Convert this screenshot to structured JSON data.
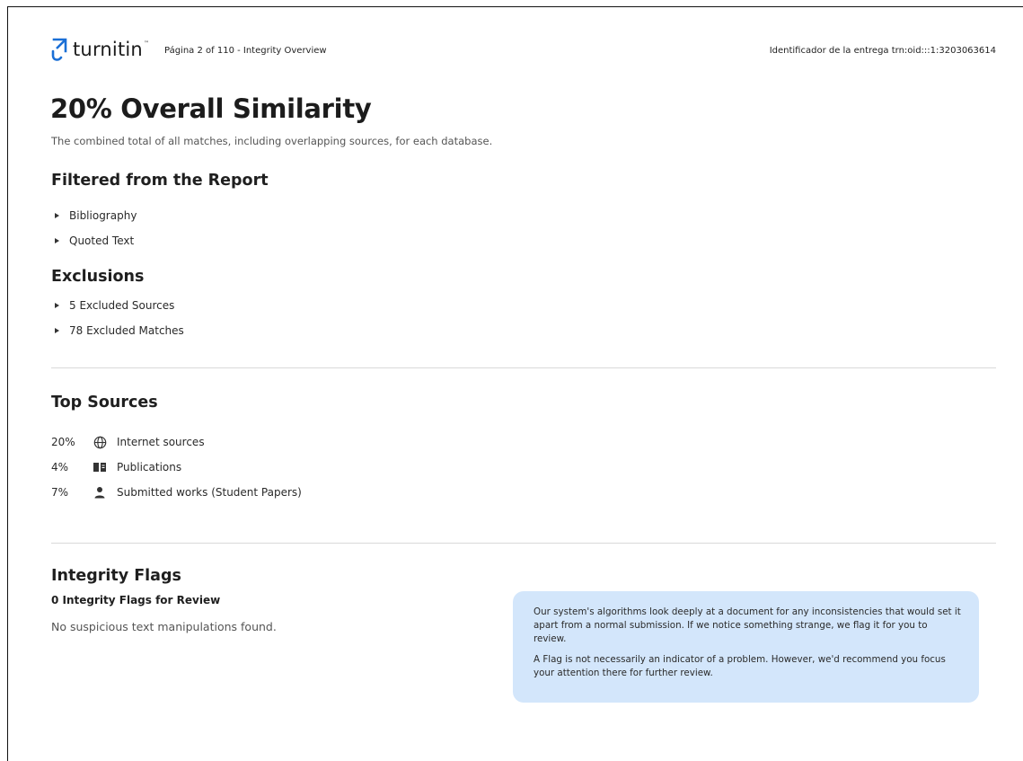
{
  "header": {
    "logo_text": "turnitin",
    "page_info": "Página 2 of 110 - Integrity Overview",
    "submission_id": "Identificador de la entrega trn:oid:::1:3203063614",
    "brand_color": "#1a6fd6"
  },
  "overview": {
    "title": "20% Overall Similarity",
    "subtitle": "The combined total of all matches, including overlapping sources, for each database."
  },
  "filtered": {
    "heading": "Filtered from the Report",
    "items": [
      "Bibliography",
      "Quoted Text"
    ]
  },
  "exclusions": {
    "heading": "Exclusions",
    "items": [
      "5 Excluded Sources",
      "78 Excluded Matches"
    ]
  },
  "top_sources": {
    "heading": "Top Sources",
    "rows": [
      {
        "percent": "20%",
        "icon": "globe-icon",
        "label": "Internet sources"
      },
      {
        "percent": "4%",
        "icon": "book-icon",
        "label": "Publications"
      },
      {
        "percent": "7%",
        "icon": "person-icon",
        "label": "Submitted works (Student Papers)"
      }
    ]
  },
  "integrity_flags": {
    "heading": "Integrity Flags",
    "count_label": "0 Integrity Flags for Review",
    "status": "No suspicious text manipulations found.",
    "info_paragraph_1": "Our system's algorithms look deeply at a document for any inconsistencies that would set it apart from a normal submission. If we notice something strange, we flag it for you to review.",
    "info_paragraph_2": "A Flag is not necessarily an indicator of a problem. However, we'd recommend you focus your attention there for further review.",
    "info_box_color": "#d3e6fb"
  }
}
